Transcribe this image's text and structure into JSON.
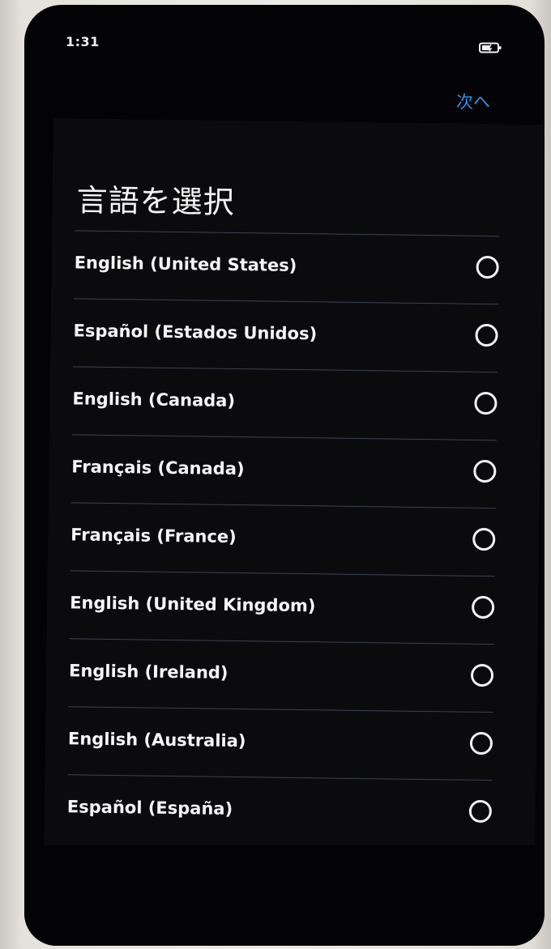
{
  "status_bar": {
    "time": "1:31",
    "battery_icon": "battery-icon"
  },
  "header": {
    "next_label": "次へ",
    "next_color": "#2f8fe8"
  },
  "page": {
    "title": "言語を選択"
  },
  "languages": [
    {
      "label": "English (United States)",
      "selected": false
    },
    {
      "label": "Español (Estados Unidos)",
      "selected": false
    },
    {
      "label": "English (Canada)",
      "selected": false
    },
    {
      "label": "Français (Canada)",
      "selected": false
    },
    {
      "label": "Français (France)",
      "selected": false
    },
    {
      "label": "English (United Kingdom)",
      "selected": false
    },
    {
      "label": "English (Ireland)",
      "selected": false
    },
    {
      "label": "English (Australia)",
      "selected": false
    },
    {
      "label": "Español (España)",
      "selected": false
    }
  ],
  "icons": {
    "radio": "radio-unselected-icon"
  }
}
